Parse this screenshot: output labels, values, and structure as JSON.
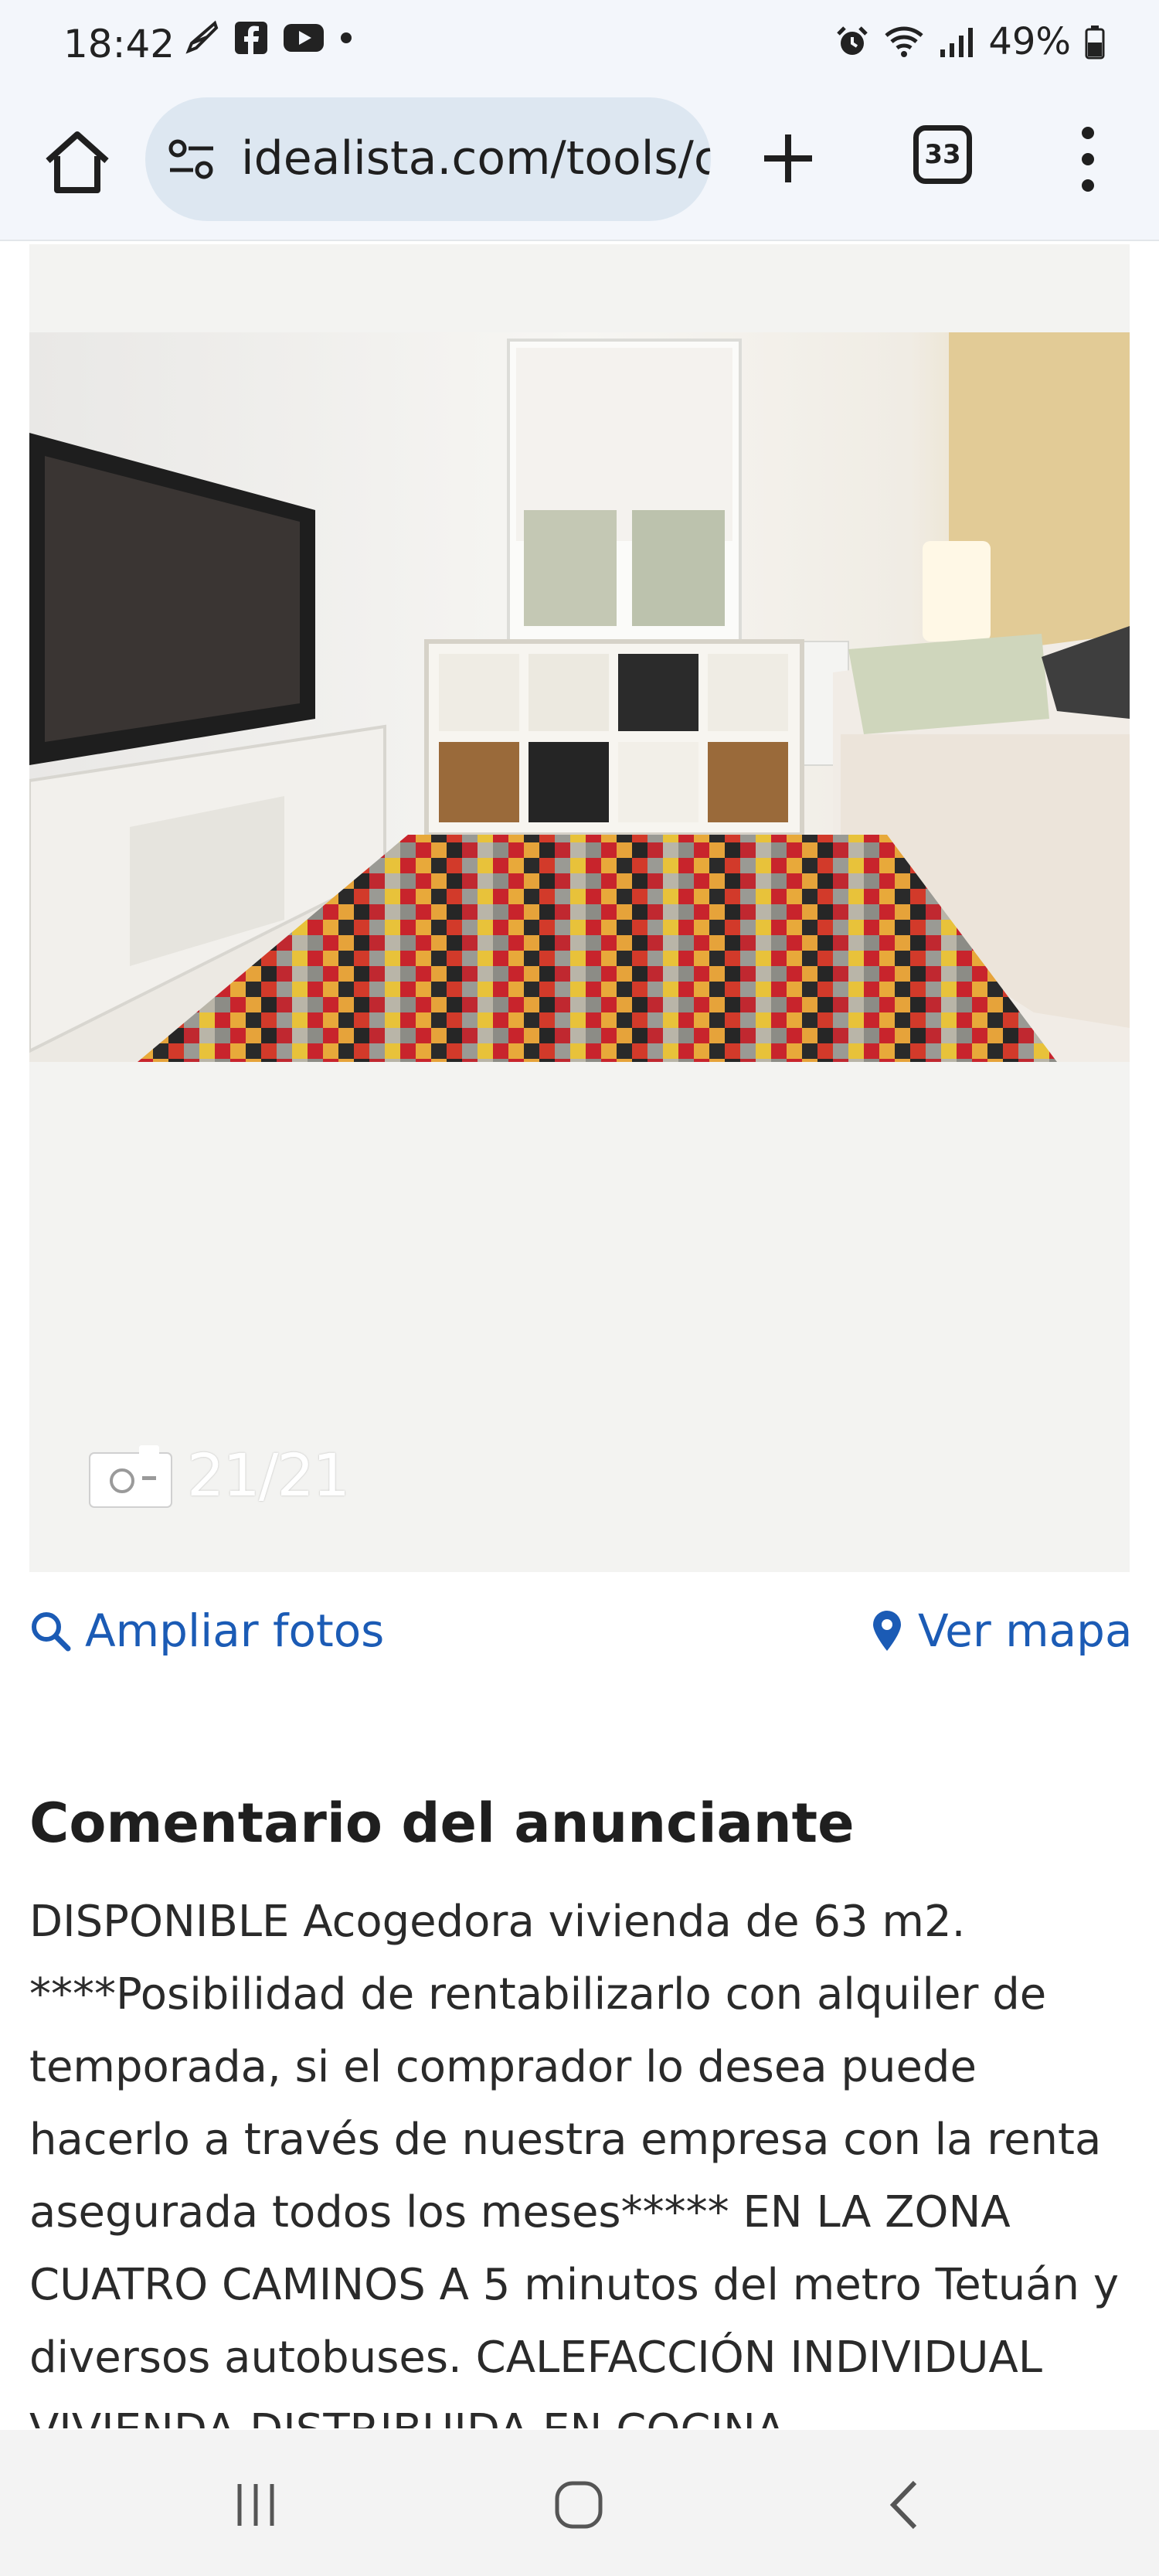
{
  "status_bar": {
    "time": "18:42",
    "battery": "49%"
  },
  "browser": {
    "url": "idealista.com/tools/c",
    "tab_count": "33"
  },
  "gallery": {
    "photo_counter": "21/21"
  },
  "links": {
    "expand_photos": "Ampliar fotos",
    "view_map": "Ver mapa"
  },
  "comment": {
    "title": "Comentario del anunciante",
    "text": "DISPONIBLE Acogedora vivienda de 63 m2. ****Posibilidad de rentabilizarlo con alquiler de temporada, si el comprador lo desea puede hacerlo a través de nuestra empresa con la renta asegurada todos los meses***** EN LA ZONA CUATRO CAMINOS A 5 minutos del metro Tetuán y diversos autobuses. CALEFACCIÓN INDIVIDUAL VIVIENDA DISTRIBUIDA EN COCINA"
  },
  "colors": {
    "accent": "#1b5bb5",
    "url_pill": "#dde7f1"
  }
}
